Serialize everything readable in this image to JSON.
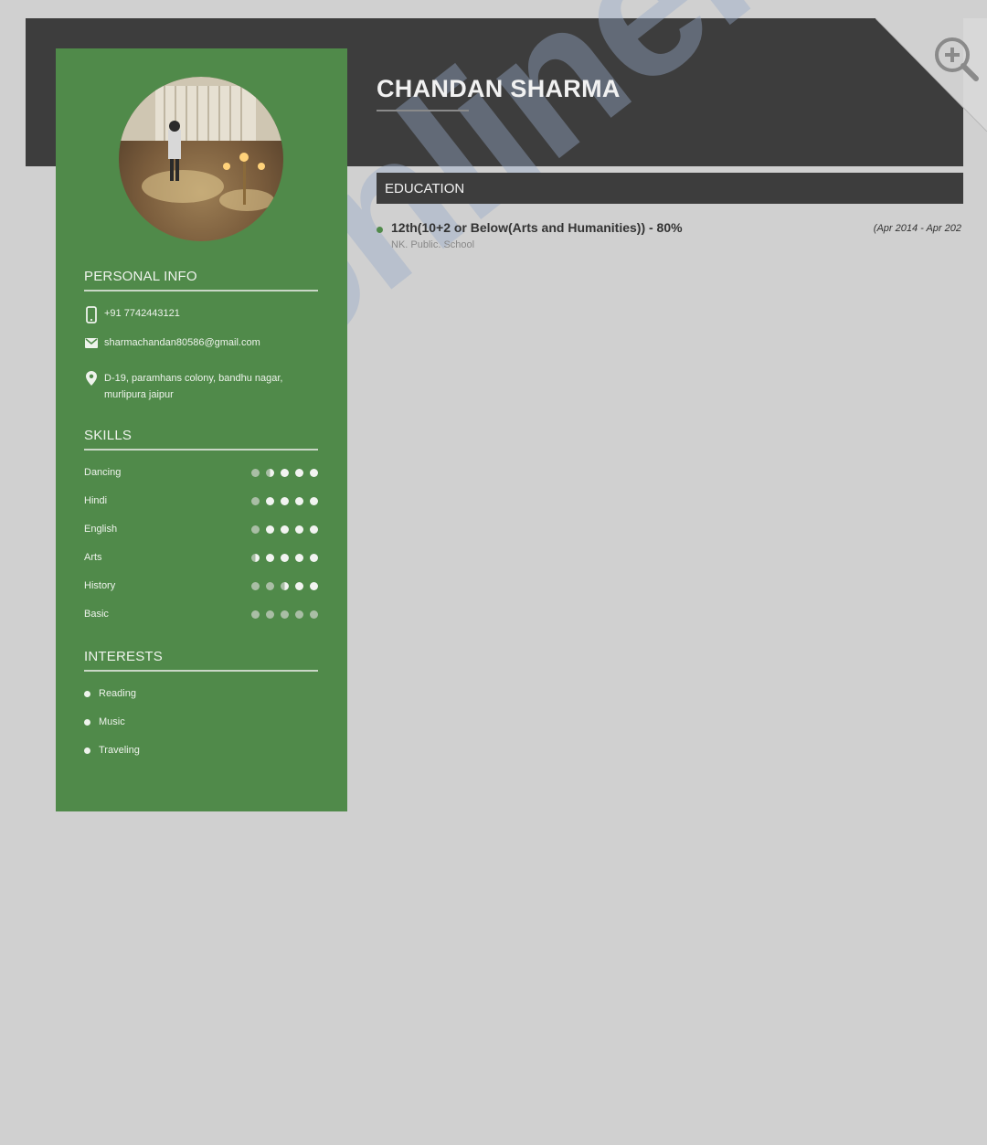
{
  "header": {
    "name": "CHANDAN SHARMA"
  },
  "watermark": {
    "text": "onlinelearn"
  },
  "colors": {
    "sidebar": "#508a4a",
    "header": "#3d3d3d",
    "background": "#d0d0d0"
  },
  "personal_info": {
    "title": "PERSONAL INFO",
    "phone": "+91 7742443121",
    "email": "sharmachandan80586@gmail.com",
    "address": "D-19, paramhans colony, bandhu nagar, murlipura jaipur"
  },
  "skills": {
    "title": "SKILLS",
    "items": [
      {
        "name": "Dancing",
        "rating": 3.5
      },
      {
        "name": "Hindi",
        "rating": 4
      },
      {
        "name": "English",
        "rating": 4
      },
      {
        "name": "Arts",
        "rating": 4.5
      },
      {
        "name": "History",
        "rating": 2.5
      },
      {
        "name": "Basic",
        "rating": 0
      }
    ]
  },
  "interests": {
    "title": "INTERESTS",
    "items": [
      "Reading",
      "Music",
      "Traveling"
    ]
  },
  "education": {
    "title": "EDUCATION",
    "entries": [
      {
        "degree": "12th(10+2 or Below(Arts and Humanities)) - 80%",
        "dates": "(Apr 2014 - Apr 202",
        "school": "NK. Public. School"
      }
    ]
  },
  "icons": [
    "phone-icon",
    "email-icon",
    "location-icon",
    "zoom-in-icon"
  ]
}
